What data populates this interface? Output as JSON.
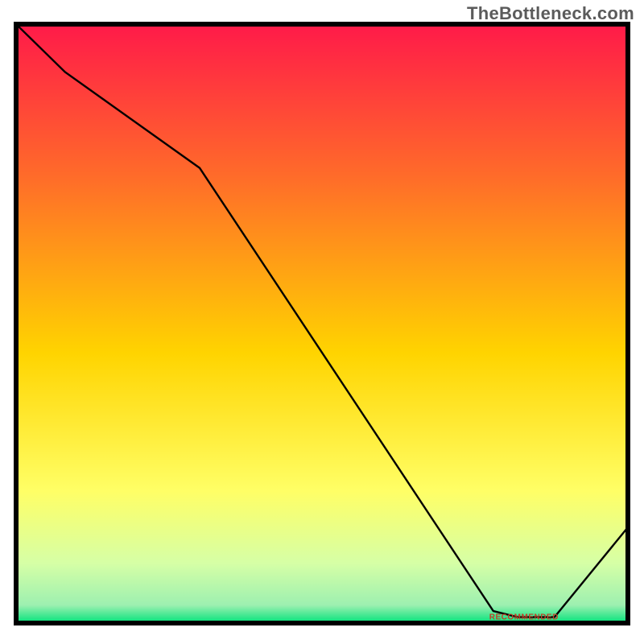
{
  "attribution": "TheBottleneck.com",
  "chart_data": {
    "type": "line",
    "title": "",
    "xlabel": "",
    "ylabel": "",
    "xlim": [
      0,
      100
    ],
    "ylim": [
      0,
      100
    ],
    "grid": false,
    "background": "red-yellow-green vertical gradient",
    "series": [
      {
        "name": "curve",
        "x": [
          0,
          8,
          30,
          78,
          82,
          88,
          100
        ],
        "y": [
          100,
          92,
          76,
          2,
          1,
          1,
          16
        ]
      }
    ],
    "annotations": [
      {
        "text": "RECOMMENDED",
        "x": 83,
        "y": 1,
        "color": "#c04028",
        "size": "tiny"
      }
    ]
  },
  "colors": {
    "gradient_top": "#ff1a49",
    "gradient_mid1": "#ff6a2a",
    "gradient_mid2": "#ffd400",
    "gradient_mid3": "#ffff66",
    "gradient_bottom1": "#d6ffa6",
    "gradient_bottom2": "#00e27a",
    "frame": "#000000",
    "line": "#000000",
    "annotation": "#c04028"
  }
}
